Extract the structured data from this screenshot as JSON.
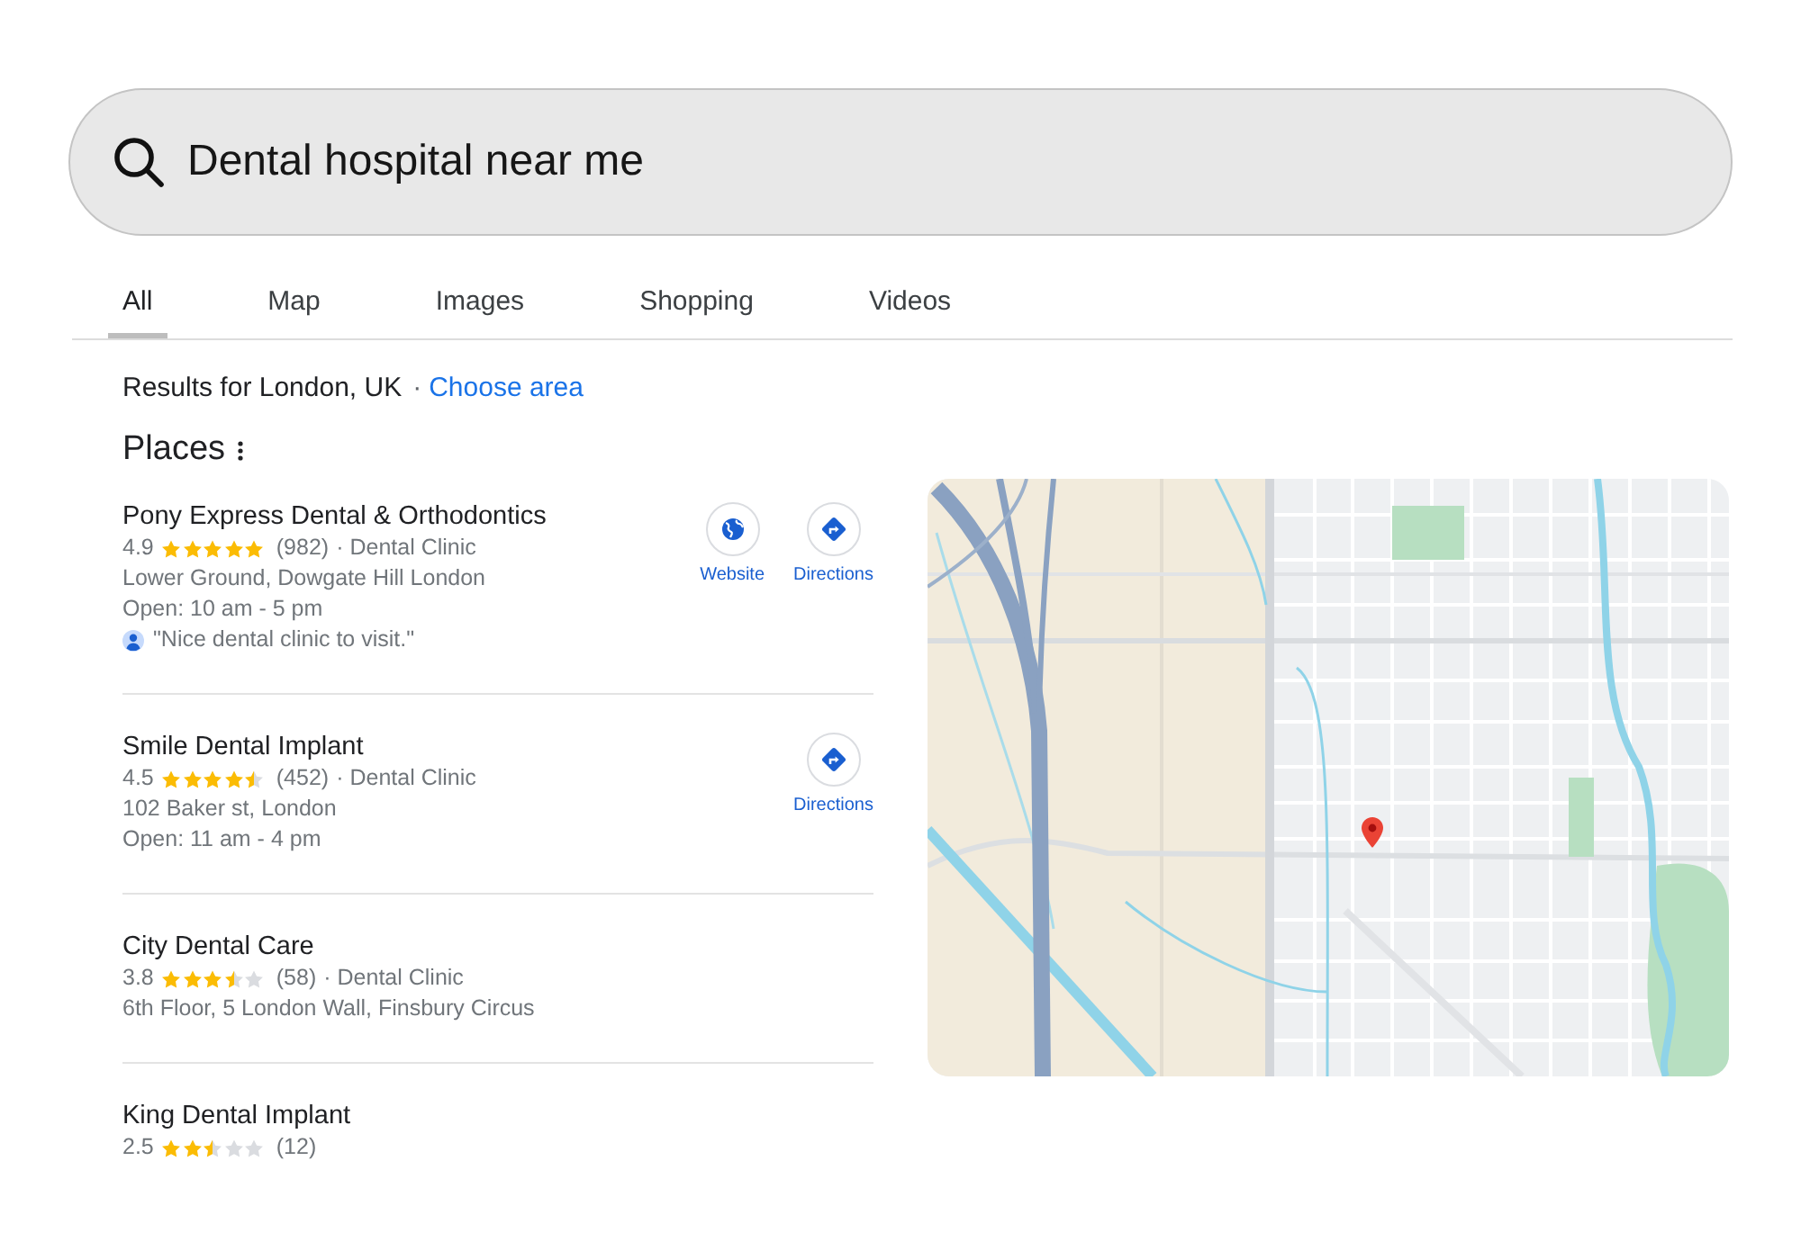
{
  "search": {
    "query": "Dental hospital near me"
  },
  "tabs": [
    {
      "label": "All",
      "selected": true
    },
    {
      "label": "Map",
      "selected": false
    },
    {
      "label": "Images",
      "selected": false
    },
    {
      "label": "Shopping",
      "selected": false
    },
    {
      "label": "Videos",
      "selected": false
    }
  ],
  "location": {
    "text": "Results for London, UK",
    "separator": "·",
    "link": "Choose area"
  },
  "places": {
    "title": "Places",
    "results": [
      {
        "name": "Pony Express Dental & Orthodontics",
        "rating": "4.9",
        "stars": 5,
        "reviews": "(982)",
        "category": "· Dental Clinic",
        "address": "Lower Ground, Dowgate Hill London",
        "hours": "Open: 10 am - 5 pm",
        "review": "\"Nice dental clinic to visit.\"",
        "actions": [
          {
            "kind": "website",
            "label": "Website"
          },
          {
            "kind": "directions",
            "label": "Directions"
          }
        ]
      },
      {
        "name": "Smile Dental Implant",
        "rating": "4.5",
        "stars": 4.5,
        "reviews": "(452)",
        "category": "· Dental Clinic",
        "address": "102 Baker st, London",
        "hours": "Open: 11 am - 4 pm",
        "actions": [
          {
            "kind": "directions",
            "label": "Directions"
          }
        ]
      },
      {
        "name": "City Dental Care",
        "rating": "3.8",
        "stars": 3.5,
        "reviews": "(58)",
        "category": "· Dental Clinic",
        "address": "6th Floor, 5 London Wall, Finsbury Circus"
      },
      {
        "name": "King Dental Implant",
        "rating": "2.5",
        "stars": 2.5,
        "reviews": "(12)"
      }
    ]
  }
}
